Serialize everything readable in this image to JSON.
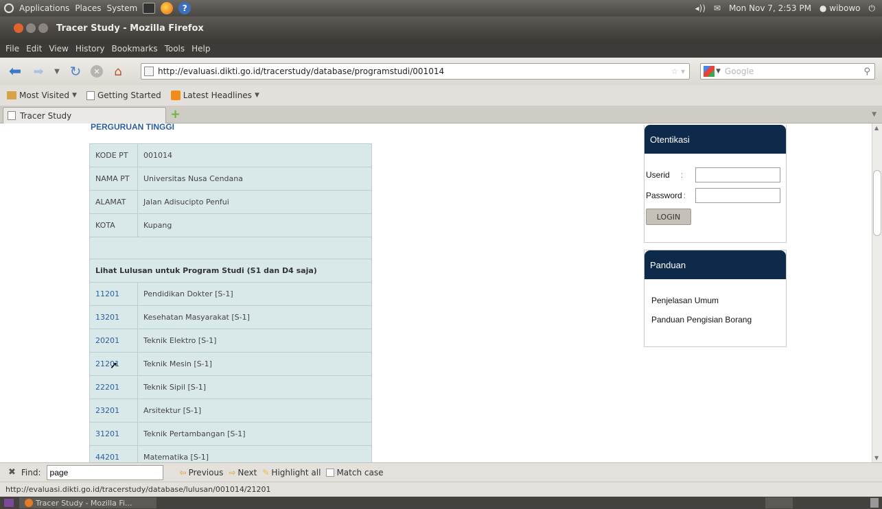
{
  "top_panel": {
    "menus": [
      "Applications",
      "Places",
      "System"
    ],
    "clock": "Mon Nov 7, 2:53 PM",
    "user": "wibowo"
  },
  "window": {
    "title": "Tracer Study - Mozilla Firefox"
  },
  "menu_bar": [
    "File",
    "Edit",
    "View",
    "History",
    "Bookmarks",
    "Tools",
    "Help"
  ],
  "nav": {
    "url": "http://evaluasi.dikti.go.id/tracerstudy/database/programstudi/001014",
    "search_placeholder": "Google"
  },
  "bookmarks": [
    "Most Visited",
    "Getting Started",
    "Latest Headlines"
  ],
  "tab": {
    "title": "Tracer Study"
  },
  "page": {
    "heading": "PERGURUAN TINGGI",
    "info": [
      {
        "label": "KODE PT",
        "value": "001014"
      },
      {
        "label": "NAMA PT",
        "value": "Universitas Nusa Cendana"
      },
      {
        "label": "ALAMAT",
        "value": "Jalan Adisucipto Penfui"
      },
      {
        "label": "KOTA",
        "value": "Kupang"
      }
    ],
    "programs_heading": "Lihat Lulusan untuk Program Studi (S1 dan D4 saja)",
    "programs": [
      {
        "code": "11201",
        "name": "Pendidikan Dokter [S-1]"
      },
      {
        "code": "13201",
        "name": "Kesehatan Masyarakat [S-1]"
      },
      {
        "code": "20201",
        "name": "Teknik Elektro [S-1]"
      },
      {
        "code": "21201",
        "name": "Teknik Mesin [S-1]"
      },
      {
        "code": "22201",
        "name": "Teknik Sipil [S-1]"
      },
      {
        "code": "23201",
        "name": "Arsitektur [S-1]"
      },
      {
        "code": "31201",
        "name": "Teknik Pertambangan [S-1]"
      },
      {
        "code": "44201",
        "name": "Matematika [S-1]"
      }
    ]
  },
  "sidebar": {
    "login_title": "Otentikasi",
    "userid_label": "Userid",
    "password_label": "Password",
    "login_button": "LOGIN",
    "guide_title": "Panduan",
    "guide_links": [
      "Penjelasan Umum",
      "Panduan Pengisian Borang"
    ]
  },
  "find_bar": {
    "label": "Find:",
    "value": "page",
    "previous": "Previous",
    "next": "Next",
    "highlight": "Highlight all",
    "match_case": "Match case"
  },
  "status": "http://evaluasi.dikti.go.id/tracerstudy/database/lulusan/001014/21201",
  "taskbar": {
    "item": "Tracer Study - Mozilla Fi..."
  }
}
